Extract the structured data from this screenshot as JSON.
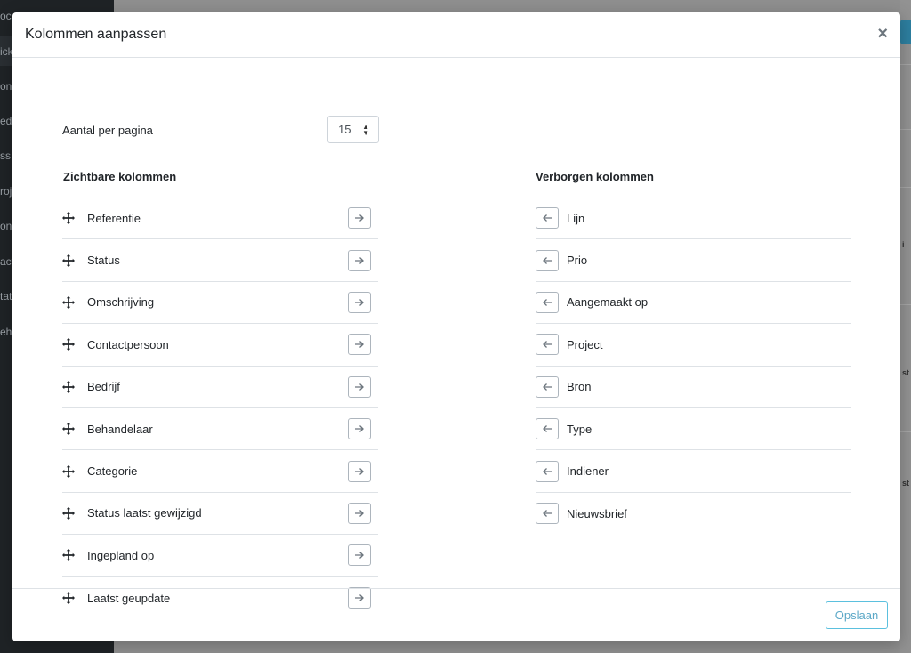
{
  "background": {
    "sidebar_fragments": [
      "oc",
      "ick",
      "on",
      "ed",
      "ss",
      "roj",
      "on",
      "act",
      "tat",
      "eh"
    ],
    "right_fragments": [
      "i",
      "st",
      "st"
    ]
  },
  "modal": {
    "title": "Kolommen aanpassen",
    "close_label": "×",
    "per_page": {
      "label": "Aantal per pagina",
      "value": "15"
    },
    "visible": {
      "heading": "Zichtbare kolommen",
      "items": [
        "Referentie",
        "Status",
        "Omschrijving",
        "Contactpersoon",
        "Bedrijf",
        "Behandelaar",
        "Categorie",
        "Status laatst gewijzigd",
        "Ingepland op",
        "Laatst geupdate"
      ]
    },
    "hidden": {
      "heading": "Verborgen kolommen",
      "items": [
        "Lijn",
        "Prio",
        "Aangemaakt op",
        "Project",
        "Bron",
        "Type",
        "Indiener",
        "Nieuwsbrief"
      ]
    },
    "save_label": "Opslaan"
  },
  "colors": {
    "accent": "#5bc0de",
    "border": "#dee2e6",
    "sidebar": "#1f2326"
  },
  "icons": {
    "drag": "move-icon",
    "to_hidden": "arrow-right-icon",
    "to_visible": "arrow-left-icon"
  }
}
